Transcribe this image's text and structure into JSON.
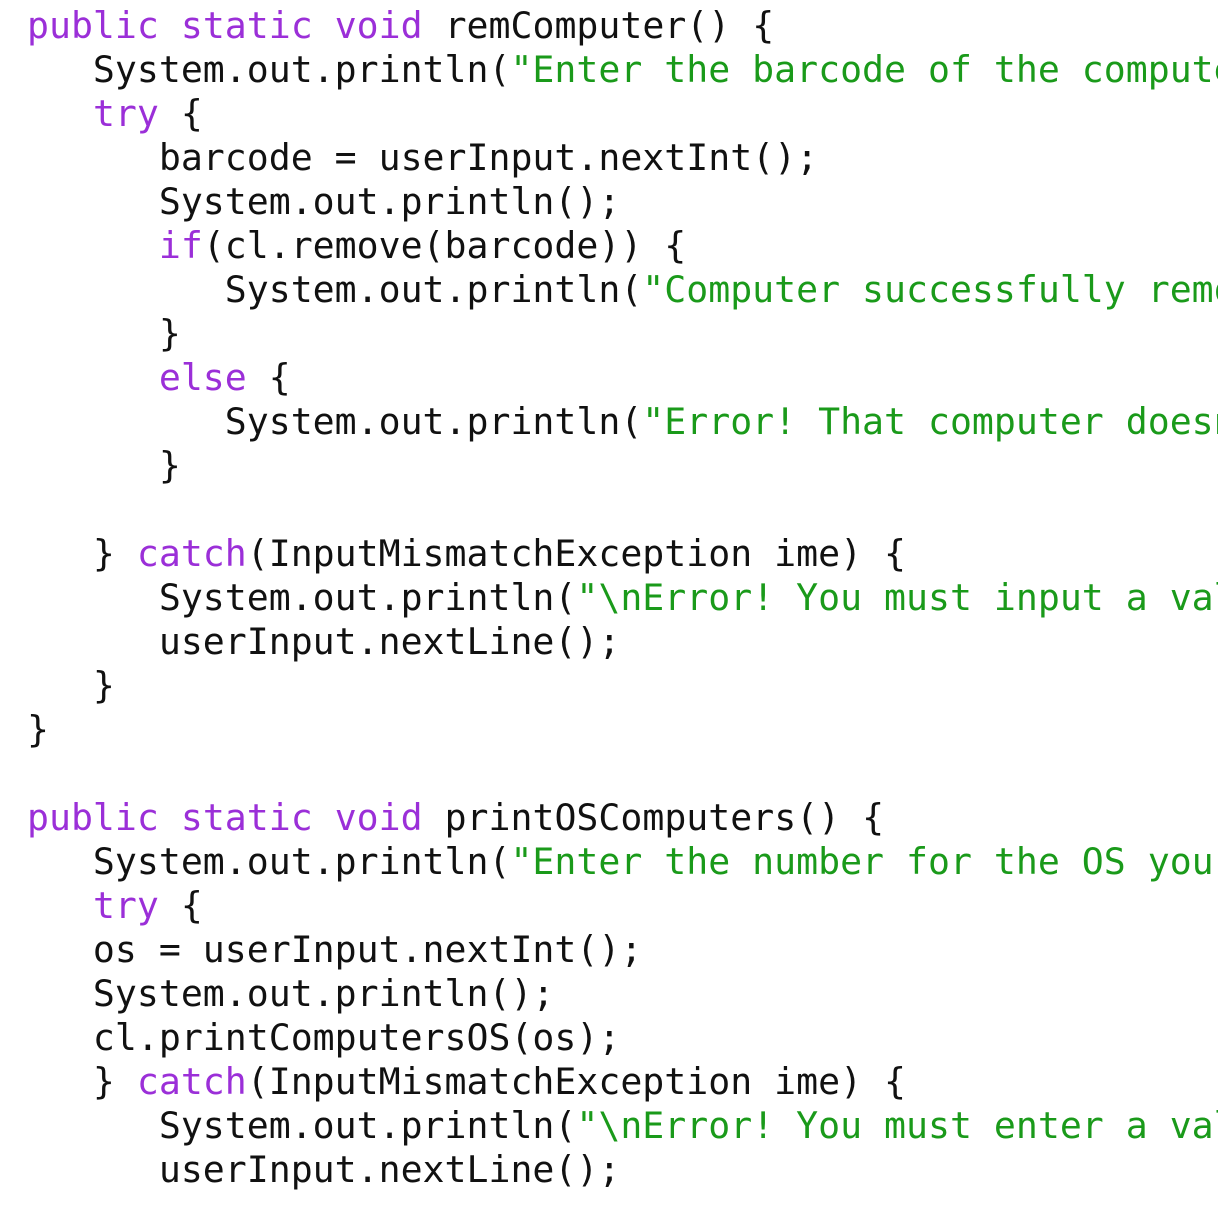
{
  "editor": {
    "colors": {
      "background": "#ffffff",
      "keyword": "#9b2fd8",
      "string": "#1a9a1a",
      "plain": "#111111"
    },
    "lines": [
      {
        "tokens": [
          {
            "t": "keyword",
            "v": "public"
          },
          {
            "t": "plain",
            "v": " "
          },
          {
            "t": "keyword",
            "v": "static"
          },
          {
            "t": "plain",
            "v": " "
          },
          {
            "t": "keyword",
            "v": "void"
          },
          {
            "t": "plain",
            "v": " remComputer() {"
          }
        ]
      },
      {
        "tokens": [
          {
            "t": "plain",
            "v": "   System.out.println("
          },
          {
            "t": "string",
            "v": "\"Enter the barcode of the compute"
          }
        ]
      },
      {
        "tokens": [
          {
            "t": "plain",
            "v": "   "
          },
          {
            "t": "keyword",
            "v": "try"
          },
          {
            "t": "plain",
            "v": " {"
          }
        ]
      },
      {
        "tokens": [
          {
            "t": "plain",
            "v": "      barcode = userInput.nextInt();"
          }
        ]
      },
      {
        "tokens": [
          {
            "t": "plain",
            "v": "      System.out.println();"
          }
        ]
      },
      {
        "tokens": [
          {
            "t": "plain",
            "v": "      "
          },
          {
            "t": "keyword",
            "v": "if"
          },
          {
            "t": "plain",
            "v": "(cl.remove(barcode)) {"
          }
        ]
      },
      {
        "tokens": [
          {
            "t": "plain",
            "v": "         System.out.println("
          },
          {
            "t": "string",
            "v": "\"Computer successfully remo"
          }
        ]
      },
      {
        "tokens": [
          {
            "t": "plain",
            "v": "      }"
          }
        ]
      },
      {
        "tokens": [
          {
            "t": "plain",
            "v": "      "
          },
          {
            "t": "keyword",
            "v": "else"
          },
          {
            "t": "plain",
            "v": " {"
          }
        ]
      },
      {
        "tokens": [
          {
            "t": "plain",
            "v": "         System.out.println("
          },
          {
            "t": "string",
            "v": "\"Error! That computer doesn"
          }
        ]
      },
      {
        "tokens": [
          {
            "t": "plain",
            "v": "      }"
          }
        ]
      },
      {
        "tokens": [
          {
            "t": "plain",
            "v": ""
          }
        ]
      },
      {
        "tokens": [
          {
            "t": "plain",
            "v": "   } "
          },
          {
            "t": "keyword",
            "v": "catch"
          },
          {
            "t": "plain",
            "v": "(InputMismatchException ime) {"
          }
        ]
      },
      {
        "tokens": [
          {
            "t": "plain",
            "v": "      System.out.println("
          },
          {
            "t": "string",
            "v": "\"\\nError! You must input a val"
          }
        ]
      },
      {
        "tokens": [
          {
            "t": "plain",
            "v": "      userInput.nextLine();"
          }
        ]
      },
      {
        "tokens": [
          {
            "t": "plain",
            "v": "   }"
          }
        ]
      },
      {
        "tokens": [
          {
            "t": "plain",
            "v": "}"
          }
        ]
      },
      {
        "tokens": [
          {
            "t": "plain",
            "v": ""
          }
        ]
      },
      {
        "tokens": [
          {
            "t": "keyword",
            "v": "public"
          },
          {
            "t": "plain",
            "v": " "
          },
          {
            "t": "keyword",
            "v": "static"
          },
          {
            "t": "plain",
            "v": " "
          },
          {
            "t": "keyword",
            "v": "void"
          },
          {
            "t": "plain",
            "v": " printOSComputers() {"
          }
        ]
      },
      {
        "tokens": [
          {
            "t": "plain",
            "v": "   System.out.println("
          },
          {
            "t": "string",
            "v": "\"Enter the number for the OS you"
          }
        ]
      },
      {
        "tokens": [
          {
            "t": "plain",
            "v": "   "
          },
          {
            "t": "keyword",
            "v": "try"
          },
          {
            "t": "plain",
            "v": " {"
          }
        ]
      },
      {
        "tokens": [
          {
            "t": "plain",
            "v": "   os = userInput.nextInt();"
          }
        ]
      },
      {
        "tokens": [
          {
            "t": "plain",
            "v": "   System.out.println();"
          }
        ]
      },
      {
        "tokens": [
          {
            "t": "plain",
            "v": "   cl.printComputersOS(os);"
          }
        ]
      },
      {
        "tokens": [
          {
            "t": "plain",
            "v": "   } "
          },
          {
            "t": "keyword",
            "v": "catch"
          },
          {
            "t": "plain",
            "v": "(InputMismatchException ime) {"
          }
        ]
      },
      {
        "tokens": [
          {
            "t": "plain",
            "v": "      System.out.println("
          },
          {
            "t": "string",
            "v": "\"\\nError! You must enter a val"
          }
        ]
      },
      {
        "tokens": [
          {
            "t": "plain",
            "v": "      userInput.nextLine();"
          }
        ]
      }
    ]
  }
}
